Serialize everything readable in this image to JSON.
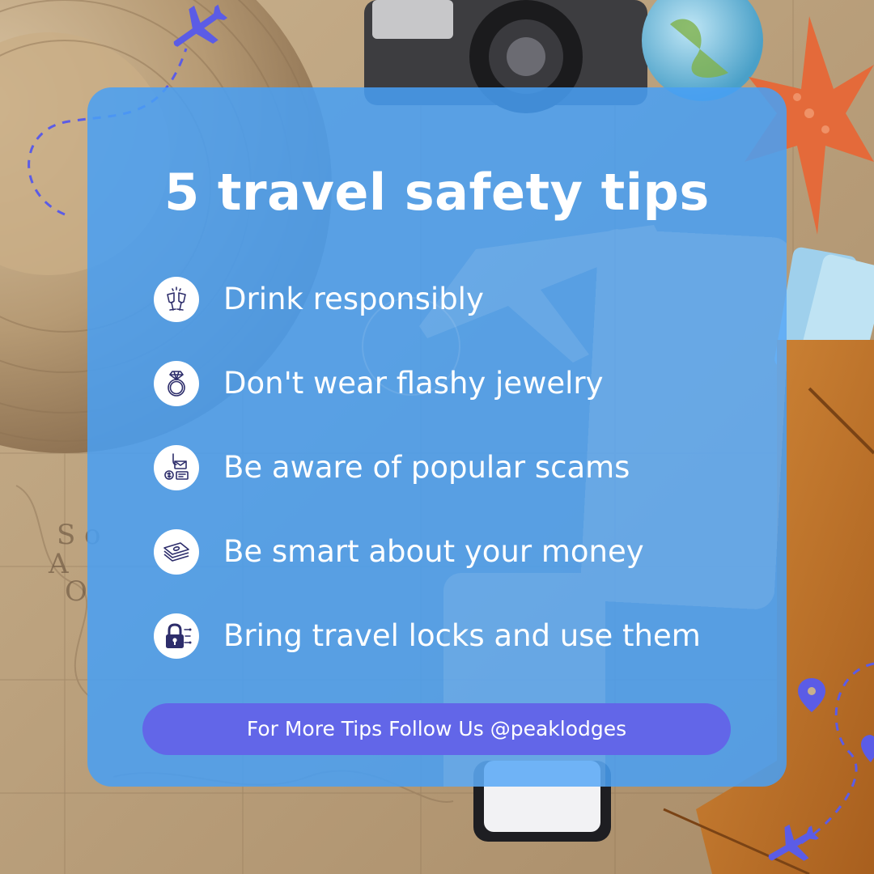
{
  "title": "5 travel safety tips",
  "tips": [
    {
      "label": "Drink responsibly",
      "icon": "cheers-glasses-icon"
    },
    {
      "label": "Don't wear flashy jewelry",
      "icon": "diamond-ring-icon"
    },
    {
      "label": "Be aware of popular scams",
      "icon": "phishing-scam-icon"
    },
    {
      "label": "Be smart about your money",
      "icon": "money-stack-icon"
    },
    {
      "label": "Bring travel locks and use them",
      "icon": "padlock-icon"
    }
  ],
  "cta": {
    "label": "For More Tips Follow Us @peaklodges"
  },
  "decorations": [
    "airplane-icon",
    "airplane-icon",
    "location-pin-icon",
    "location-pin-icon",
    "dashed-flight-path"
  ],
  "colors": {
    "card": "#48a0f5",
    "cta": "#6266e8",
    "text": "#ffffff",
    "icon_circle": "#ffffff",
    "icon_stroke": "#2d2d6b",
    "accent_plane": "#5b5ce6"
  }
}
